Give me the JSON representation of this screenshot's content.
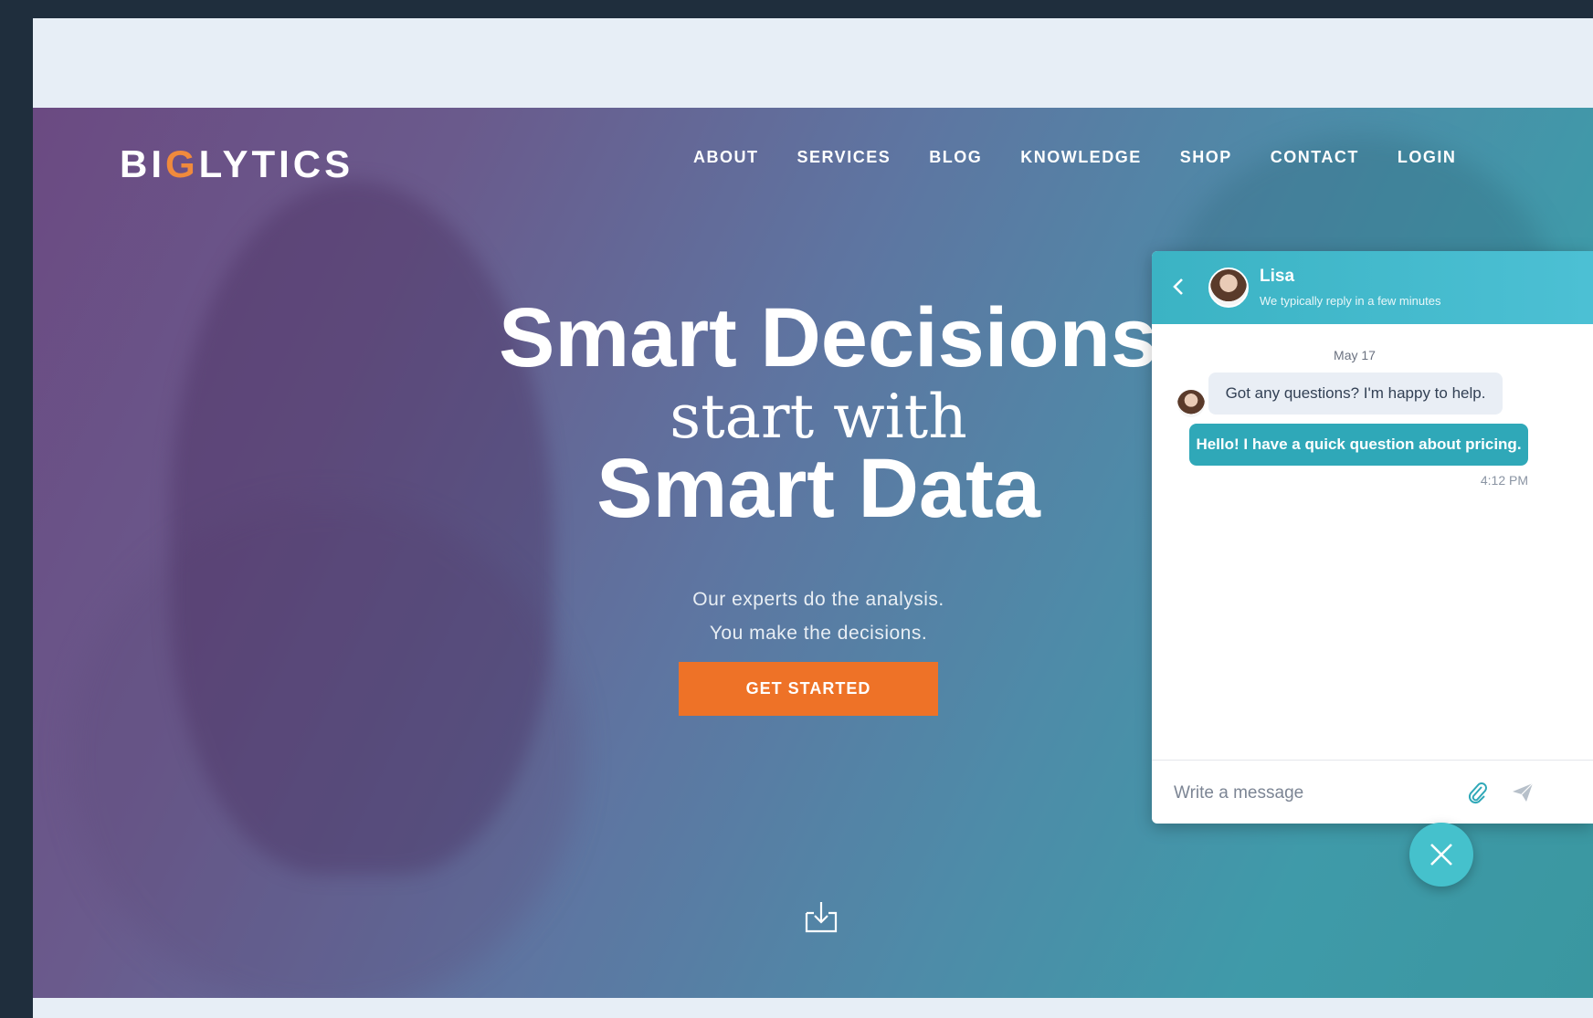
{
  "brand": {
    "prefix": "BI",
    "g": "G",
    "suffix": "LYTICS"
  },
  "nav": {
    "items": [
      {
        "label": "ABOUT"
      },
      {
        "label": "SERVICES"
      },
      {
        "label": "BLOG"
      },
      {
        "label": "KNOWLEDGE"
      },
      {
        "label": "SHOP"
      },
      {
        "label": "CONTACT"
      },
      {
        "label": "LOGIN"
      }
    ]
  },
  "hero": {
    "line1": "Smart Decisions",
    "line2": "start with",
    "line3": "Smart Data",
    "sub1": "Our experts do the analysis.",
    "sub2": "You make the decisions.",
    "cta": "GET STARTED",
    "accent_color": "#ee7227"
  },
  "chat": {
    "agent_name": "Lisa",
    "status": "We typically reply in a few minutes",
    "date": "May 17",
    "messages": [
      {
        "from": "agent",
        "text": "Got any questions? I'm happy to help."
      },
      {
        "from": "user",
        "text": "Hello! I have a quick question about pricing."
      }
    ],
    "time": "4:12 PM",
    "input_placeholder": "Write a message",
    "header_color": "#3bb3c4"
  },
  "icons": {
    "back": "chevron-left-icon",
    "attach": "paperclip-icon",
    "send": "send-icon",
    "close": "close-icon",
    "scroll": "download-tray-icon"
  }
}
